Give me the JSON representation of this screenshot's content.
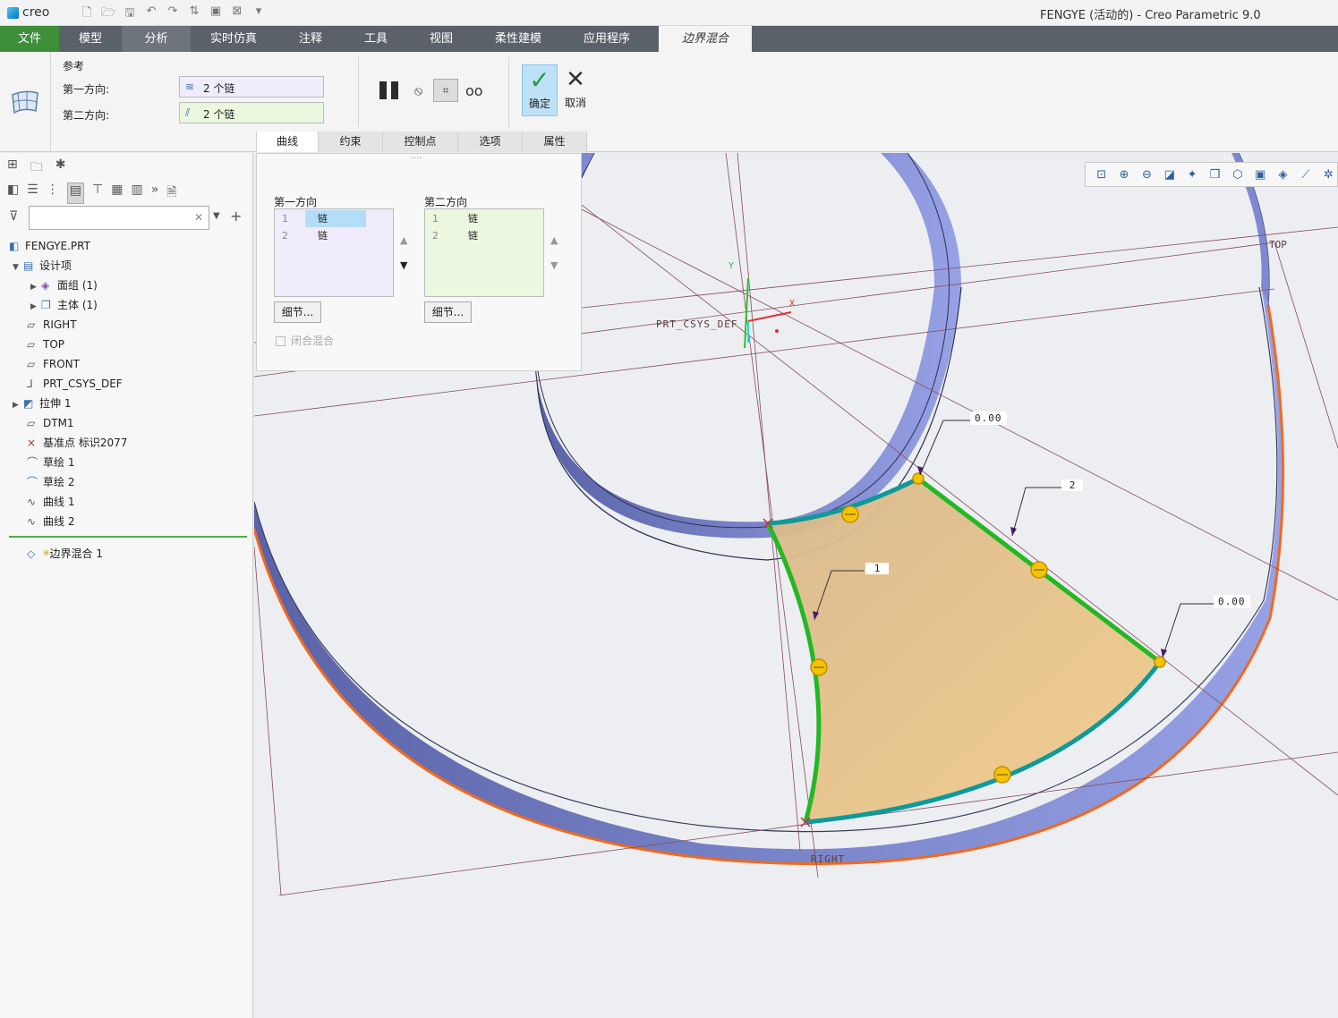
{
  "app": {
    "logo": "creo",
    "window_title": "FENGYE (活动的) - Creo Parametric 9.0"
  },
  "tabs": [
    "文件",
    "模型",
    "分析",
    "实时仿真",
    "注释",
    "工具",
    "视图",
    "柔性建模",
    "应用程序",
    "边界混合"
  ],
  "ribbon": {
    "references_title": "参考",
    "first_direction_label": "第一方向:",
    "first_direction_value": "2 个链",
    "second_direction_label": "第二方向:",
    "second_direction_value": "2 个链",
    "ok_label": "确定",
    "cancel_label": "取消",
    "subtabs": [
      "曲线",
      "约束",
      "控制点",
      "选项",
      "属性"
    ]
  },
  "curves_panel": {
    "first_title": "第一方向",
    "second_title": "第二方向",
    "first_rows": [
      {
        "n": "1",
        "v": "链"
      },
      {
        "n": "2",
        "v": "链"
      }
    ],
    "second_rows": [
      {
        "n": "1",
        "v": "链"
      },
      {
        "n": "2",
        "v": "链"
      }
    ],
    "detail_label": "细节...",
    "closed_blend_label": "闭合混合"
  },
  "tree": {
    "root": "FENGYE.PRT",
    "items": [
      {
        "label": "设计项",
        "icon": "design-items-icon"
      },
      {
        "label": "面组 (1)",
        "icon": "quilt-icon"
      },
      {
        "label": "主体 (1)",
        "icon": "body-icon"
      },
      {
        "label": "RIGHT",
        "icon": "datum-plane-icon"
      },
      {
        "label": "TOP",
        "icon": "datum-plane-icon"
      },
      {
        "label": "FRONT",
        "icon": "datum-plane-icon"
      },
      {
        "label": "PRT_CSYS_DEF",
        "icon": "csys-icon"
      },
      {
        "label": "拉伸 1",
        "icon": "extrude-icon"
      },
      {
        "label": "DTM1",
        "icon": "datum-plane-icon"
      },
      {
        "label": "基准点 标识2077",
        "icon": "datum-point-icon"
      },
      {
        "label": "草绘 1",
        "icon": "sketch-icon"
      },
      {
        "label": "草绘 2",
        "icon": "sketch-icon"
      },
      {
        "label": "曲线 1",
        "icon": "curve-icon"
      },
      {
        "label": "曲线 2",
        "icon": "curve-icon"
      },
      {
        "label": "边界混合 1",
        "icon": "boundary-blend-icon"
      }
    ]
  },
  "viewport": {
    "csys_label": "PRT_CSYS_DEF",
    "top_label": "TOP",
    "right_label": "RIGHT",
    "dim_top": "0.00",
    "dim_right": "0.00",
    "callout_1": "1",
    "callout_2": "2",
    "axis_x": "X",
    "axis_y": "Y"
  },
  "colors": {
    "accent_green": "#3e8e3a",
    "surface": "#efc98b",
    "chain_green": "#2db82d",
    "ring_blue": "#8c98e0"
  }
}
